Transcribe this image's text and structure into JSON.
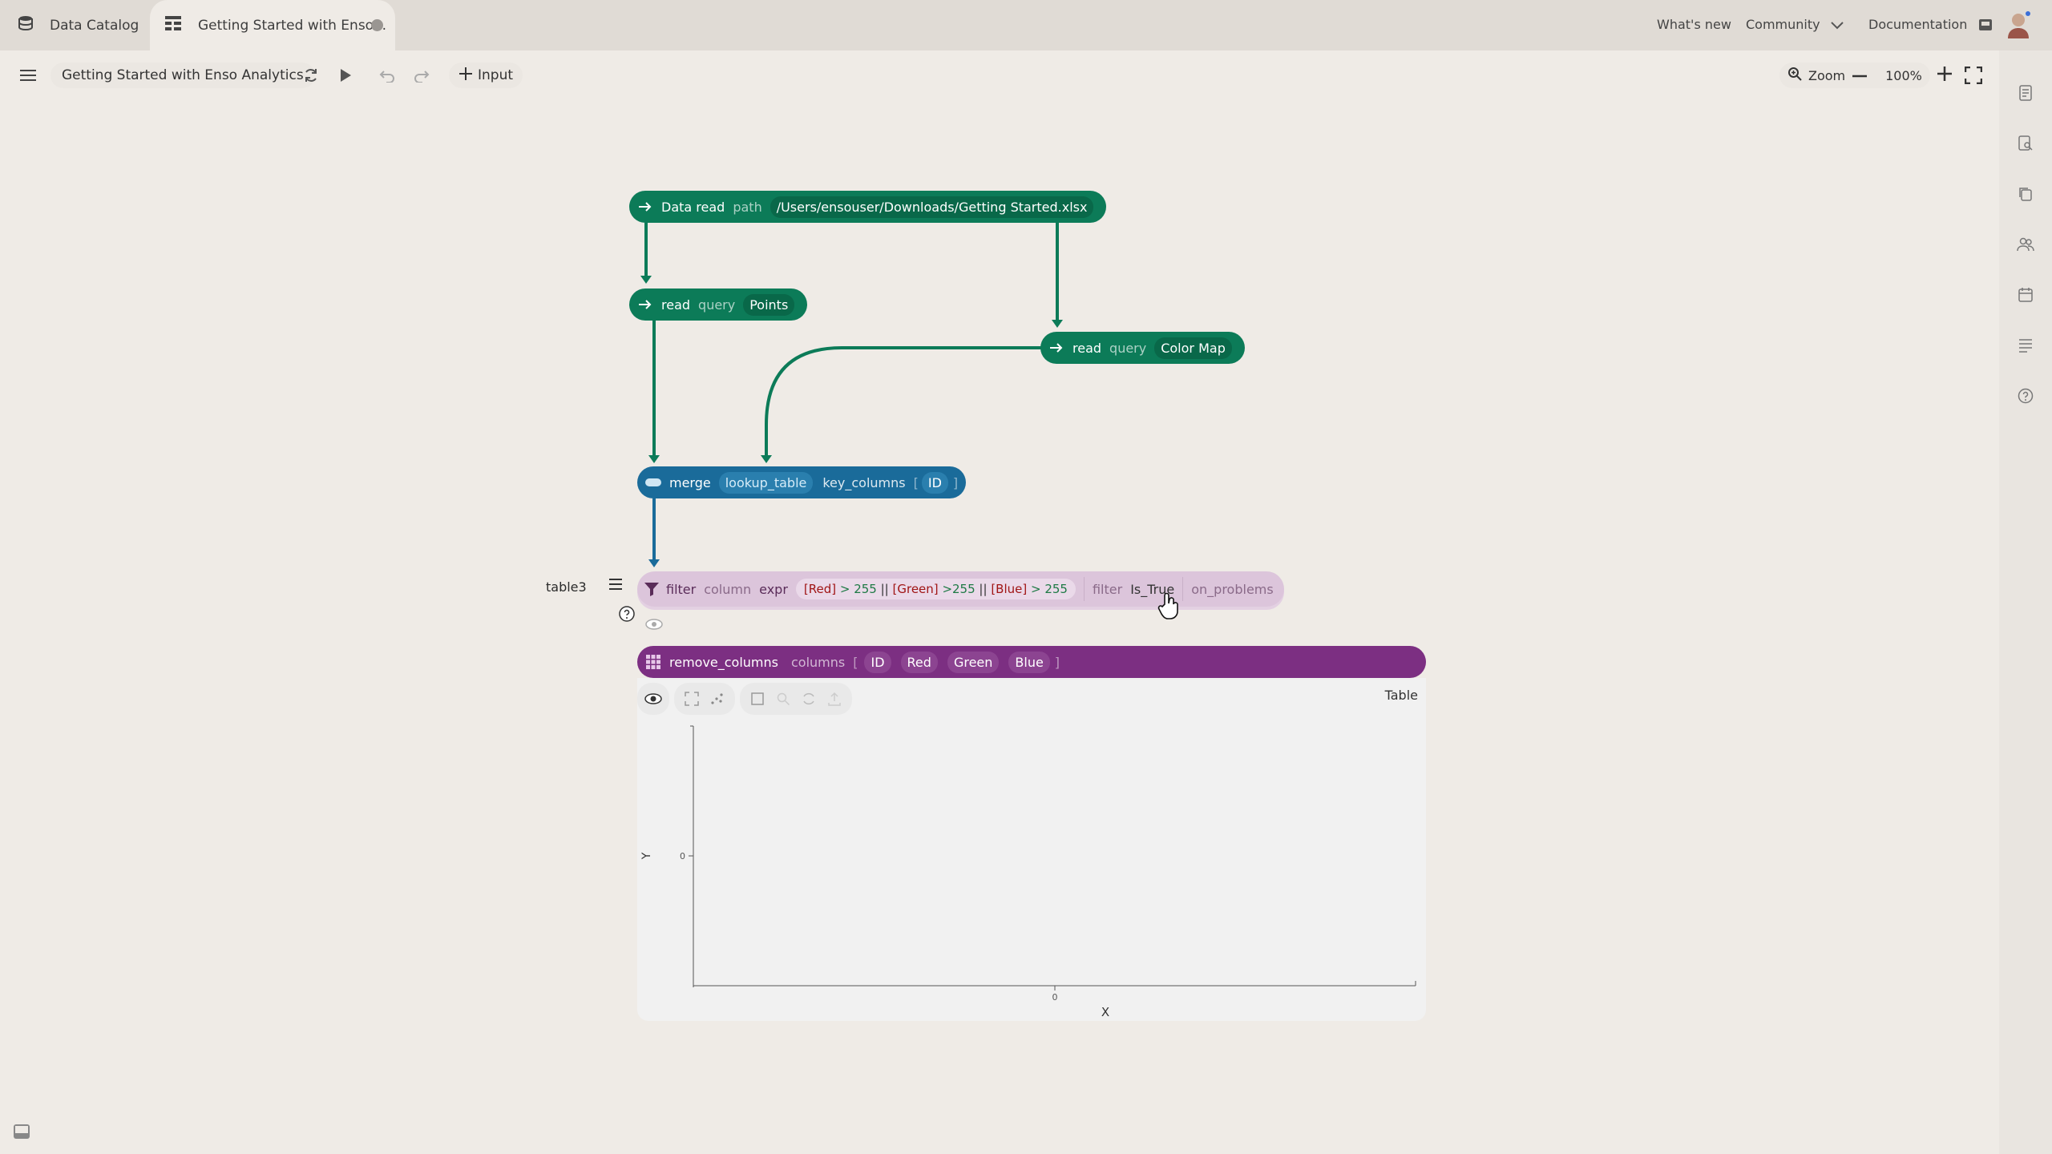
{
  "tabs": {
    "catalog_label": "Data Catalog",
    "active_label": "Getting Started with Enso..."
  },
  "top_links": {
    "whats_new": "What's new",
    "community": "Community",
    "documentation": "Documentation"
  },
  "toolbar": {
    "project_title": "Getting Started with Enso Analytics",
    "input_label": "Input",
    "zoom_label": "Zoom",
    "zoom_value": "100%"
  },
  "nodes": {
    "data_read": {
      "op": "Data read",
      "arg": "path",
      "value": "/Users/ensouser/Downloads/Getting Started.xlsx"
    },
    "read_points": {
      "op": "read",
      "arg": "query",
      "value": "Points"
    },
    "read_color": {
      "op": "read",
      "arg": "query",
      "value": "Color Map"
    },
    "merge": {
      "op": "merge",
      "arg1": "lookup_table",
      "arg2": "key_columns",
      "open": "[",
      "value": "ID",
      "close": "]"
    },
    "filter": {
      "var_name": "table3",
      "op": "filter",
      "arg1": "column",
      "arg2": "expr",
      "expr": {
        "red": "[Red]",
        "op1": "> 255",
        "or1": "||",
        "green": "[Green]",
        "op2": ">255",
        "or2": "||",
        "blue": "[Blue]",
        "op3": "> 255"
      },
      "arg3": "filter",
      "filter_value": "Is_True",
      "arg4": "on_problems"
    },
    "remove_columns": {
      "op": "remove_columns",
      "arg": "columns",
      "open": "[",
      "values": [
        "ID",
        "Red",
        "Green",
        "Blue"
      ],
      "close": "]"
    }
  },
  "visualization": {
    "type_label": "Table",
    "x_label": "X",
    "y_label": "Y",
    "x_tick": "0",
    "y_tick": "0"
  },
  "colors": {
    "green_node": "#0c7b58",
    "blue_node": "#1a6b9a",
    "filter_node": "#dcc5db",
    "purple_node": "#7c2f82"
  }
}
